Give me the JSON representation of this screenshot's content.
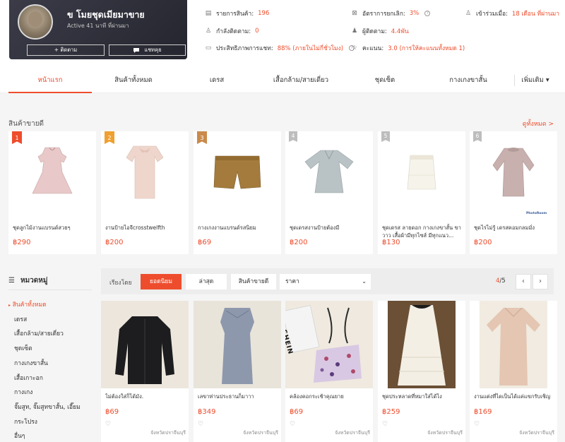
{
  "shop": {
    "name": "ข โมยชุดเมียมาขาย",
    "active": "Active 41 นาที ที่ผ่านมา",
    "follow_label": "+ ติดตาม",
    "chat_label": "แชทคุย"
  },
  "stats": {
    "products_label": "รายการสินค้า:",
    "products_value": "196",
    "following_label": "กำลังติดตาม:",
    "following_value": "0",
    "chat_label": "ประสิทธิภาพการแชท:",
    "chat_value": "88% (ภายในไม่กี่ชั่วโมง)",
    "cancel_label": "อัตราการยกเลิก:",
    "cancel_value": "3%",
    "followers_label": "ผู้ติดตาม:",
    "followers_value": "4.4พัน",
    "rating_label": "คะแนน:",
    "rating_value": "3.0 (การให้คะแนนทั้งหมด 1)",
    "joined_label": "เข้าร่วมเมื่อ:",
    "joined_value": "18 เดือน ที่ผ่านมา"
  },
  "nav": {
    "tabs": [
      "หน้าแรก",
      "สินค้าทั้งหมด",
      "เดรส",
      "เสื้อกล้าม/สายเดี่ยว",
      "ชุดเซ็ต",
      "กางเกงขาสั้น"
    ],
    "more": "เพิ่มเติม ▾"
  },
  "top_section": {
    "title": "สินค้าขายดี",
    "see_all": "ดูทั้งหมด >",
    "top_label": "TOP",
    "items": [
      {
        "rank": "1",
        "name": "ชุดลูกไม้งานแบรนด์สวยๆ",
        "price": "฿290"
      },
      {
        "rank": "2",
        "name": "งานป้ายไอจีcrosstwelfth",
        "price": "฿200"
      },
      {
        "rank": "3",
        "name": "กางเกงงานแบรนด์รสนิยม",
        "price": "฿69"
      },
      {
        "rank": "4",
        "name": "ชุดเดรสงานป้ายต้องมี",
        "price": "฿200"
      },
      {
        "rank": "5",
        "name": "ชุดเดรส ลายดอก กางเกงขาสั้น ขาวาว เสื้อผ้ามีทุกไซส์ มีทุกแนว...",
        "price": "฿130"
      },
      {
        "rank": "6",
        "name": "ชุดไรไม่รู้ เดรสคอมกลมมั่ง",
        "price": "฿200"
      }
    ]
  },
  "categories": {
    "title": "หมวดหมู่",
    "items": [
      "สินค้าทั้งหมด",
      "เดรส",
      "เสื้อกล้าม/สายเดี่ยว",
      "ชุดเซ็ต",
      "กางเกงขาสั้น",
      "เสื้อเกาะอก",
      "กางเกง",
      "จั๊มสูท, จั๊มสูทขาสั้น, เอี๊ยม",
      "กระโปรง",
      "อื่นๆ"
    ]
  },
  "sortbar": {
    "label": "เรียงโดย",
    "popular": "ยอดนิยม",
    "latest": "ล่าสุด",
    "best": "สินค้าขายดี",
    "price": "ราคา",
    "page_current": "4",
    "page_total": "/5",
    "prev": "‹",
    "next": "›"
  },
  "products": [
    {
      "name": "ไม่ต้องใส่ก็ได้มัง.",
      "price": "฿69",
      "location": "จังหวัดปราจีนบุรี"
    },
    {
      "name": "เลขาท่านประธานก็มาาา",
      "price": "฿349",
      "location": "จังหวัดปราจีนบุรี"
    },
    {
      "name": "คล้องคอกระเช้าคุณยาย",
      "price": "฿69",
      "location": "จังหวัดปราจีนบุรี"
    },
    {
      "name": "ชุดประหลาดที่หมาใส่ได้ไง",
      "price": "฿259",
      "location": "จังหวัดปราจีนบุรี"
    },
    {
      "name": "งานแต่งที่ไดเป็นได้แค่แขกรับเชิญ",
      "price": "฿169",
      "location": "จังหวัดปราจีนบุรี"
    }
  ],
  "colors": {
    "accent": "#ee4d2d",
    "header_card": "#2e2f3a"
  },
  "shein_text": "SHEIN",
  "photoroom_text": "PhotoRoom"
}
